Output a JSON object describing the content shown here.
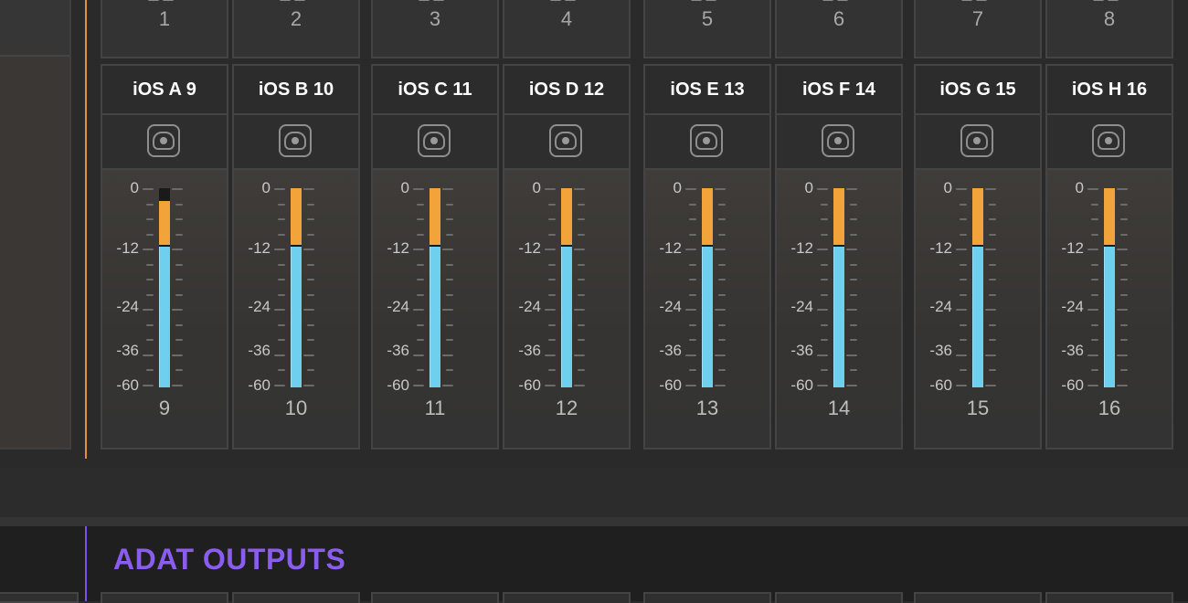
{
  "top_row": {
    "channels": [
      "1",
      "2",
      "3",
      "4",
      "5",
      "6",
      "7",
      "8"
    ]
  },
  "meter_scale": [
    "0",
    "-12",
    "-24",
    "-36",
    "-60"
  ],
  "strips": [
    {
      "name": "iOS A 9",
      "number": "9",
      "level_db": -10,
      "icon": "speaker-icon"
    },
    {
      "name": "iOS B 10",
      "number": "10",
      "level_db": -10,
      "icon": "speaker-icon"
    },
    {
      "name": "iOS C 11",
      "number": "11",
      "level_db": -10,
      "icon": "speaker-icon"
    },
    {
      "name": "iOS D 12",
      "number": "12",
      "level_db": -10,
      "icon": "speaker-icon"
    },
    {
      "name": "iOS E 13",
      "number": "13",
      "level_db": -10,
      "icon": "speaker-icon"
    },
    {
      "name": "iOS F 14",
      "number": "14",
      "level_db": -10,
      "icon": "speaker-icon"
    },
    {
      "name": "iOS G 15",
      "number": "15",
      "level_db": -10,
      "icon": "speaker-icon"
    },
    {
      "name": "iOS H 16",
      "number": "16",
      "level_db": -10,
      "icon": "speaker-icon"
    }
  ],
  "meter_colors": {
    "peak": "#f2a33a",
    "signal": "#6fcfee",
    "section_accent": "#e5913a"
  },
  "adat_section": {
    "title": "ADAT OUTPUTS",
    "accent": "#8b5cf0"
  }
}
